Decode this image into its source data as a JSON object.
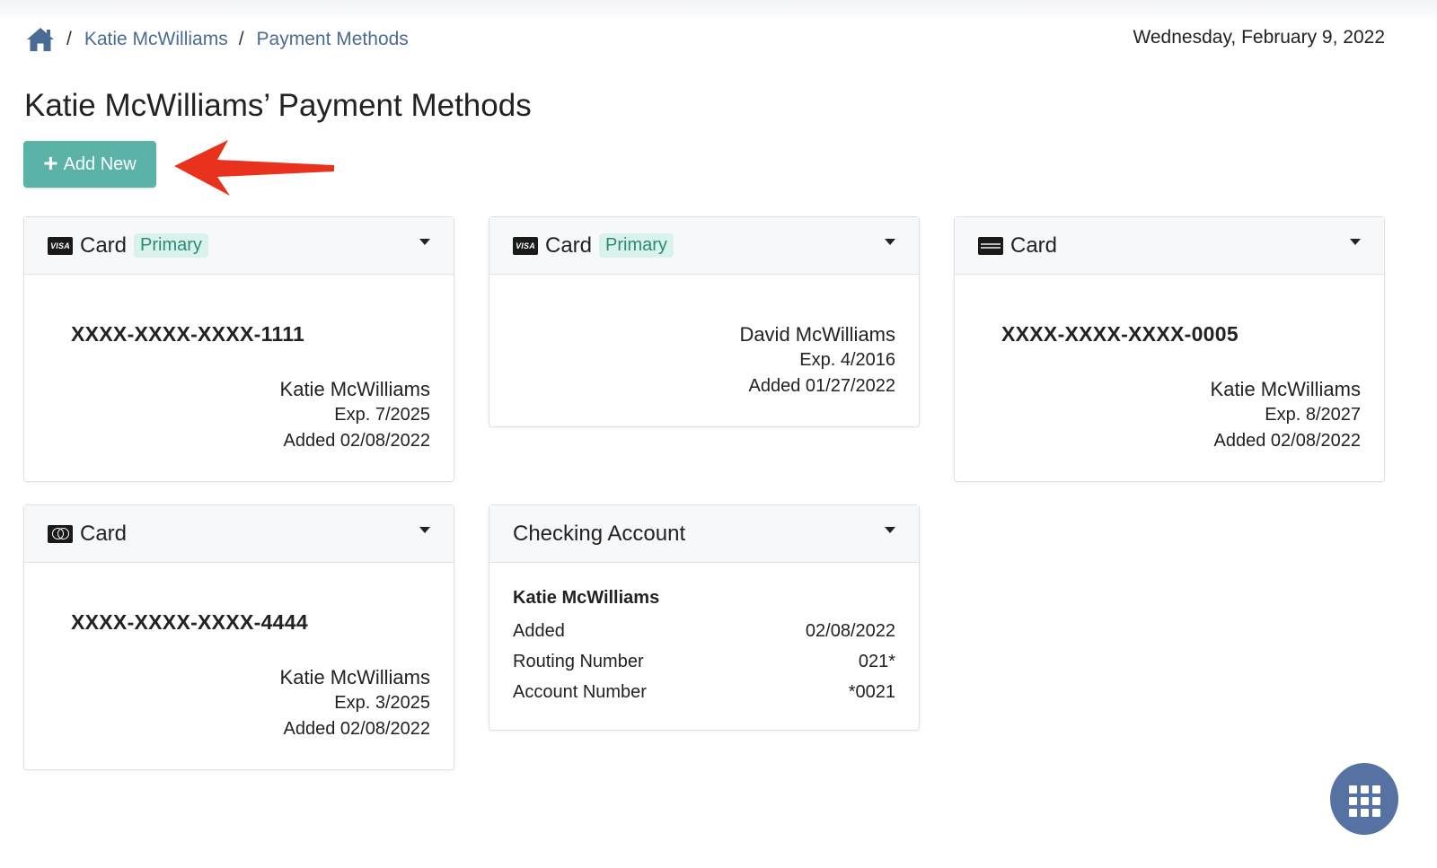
{
  "breadcrumb": {
    "home_icon": "home-icon",
    "items": [
      "Katie McWilliams",
      "Payment Methods"
    ]
  },
  "date": "Wednesday, February 9, 2022",
  "page_title": "Katie McWilliams’ Payment Methods",
  "add_button": {
    "label": "Add New",
    "color": "#5bb2a7"
  },
  "annotation_arrow_color": "#e8321e",
  "cards": [
    {
      "type_label": "Card",
      "brand_icon": "visa-icon",
      "brand_text": "VISA",
      "badge": "Primary",
      "number": "XXXX-XXXX-XXXX-1111",
      "holder": "Katie McWilliams",
      "exp": "Exp. 7/2025",
      "added": "Added 02/08/2022"
    },
    {
      "type_label": "Card",
      "brand_icon": "visa-icon",
      "brand_text": "VISA",
      "badge": "Primary",
      "number": "",
      "holder": "David McWilliams",
      "exp": "Exp. 4/2016",
      "added": "Added 01/27/2022"
    },
    {
      "type_label": "Card",
      "brand_icon": "amex-icon",
      "badge": "",
      "number": "XXXX-XXXX-XXXX-0005",
      "holder": "Katie McWilliams",
      "exp": "Exp. 8/2027",
      "added": "Added 02/08/2022"
    },
    {
      "type_label": "Card",
      "brand_icon": "mastercard-icon",
      "badge": "",
      "number": "XXXX-XXXX-XXXX-4444",
      "holder": "Katie McWilliams",
      "exp": "Exp. 3/2025",
      "added": "Added 02/08/2022"
    }
  ],
  "checking": {
    "type_label": "Checking Account",
    "holder": "Katie McWilliams",
    "rows": [
      {
        "label": "Added",
        "value": "02/08/2022"
      },
      {
        "label": "Routing Number",
        "value": "021*"
      },
      {
        "label": "Account Number",
        "value": "*0021"
      }
    ]
  },
  "fab_icon": "apps-grid-icon"
}
